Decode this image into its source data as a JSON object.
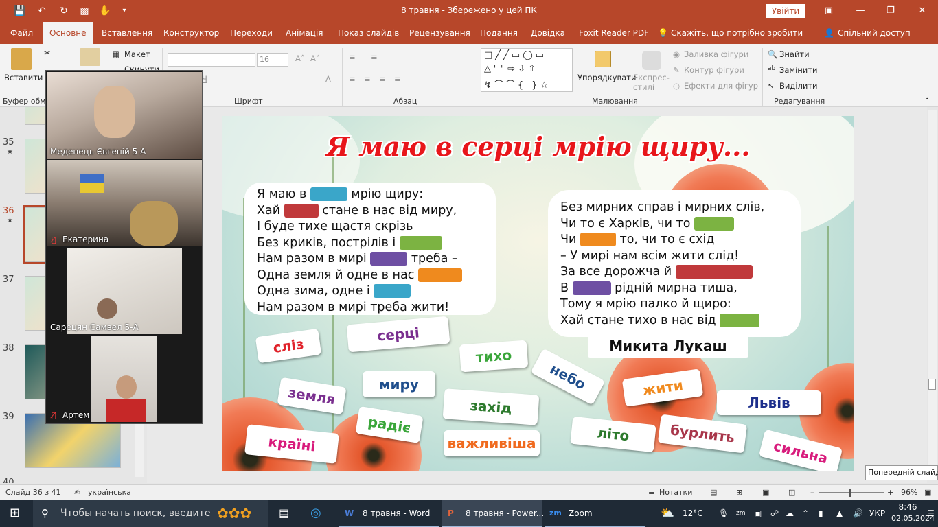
{
  "titlebar": {
    "title": "8 травня  -  Збережено у цей ПК",
    "signin": "Увійти",
    "icons": [
      "save-icon",
      "undo-icon",
      "redo-icon",
      "present-icon",
      "touch-icon",
      "customize-icon"
    ]
  },
  "menu": {
    "tabs": [
      "Файл",
      "Основне",
      "Вставлення",
      "Конструктор",
      "Переходи",
      "Анімація",
      "Показ слайдів",
      "Рецензування",
      "Подання",
      "Довідка",
      "Foxit Reader PDF"
    ],
    "tell_me": "Скажіть, що потрібно зробити",
    "share": "Спільний доступ"
  },
  "ribbon": {
    "paste": "Вставити",
    "clipboard": "Буфер обмі",
    "layout": "Макет",
    "reset": "Скинути",
    "font_group": "Шрифт",
    "font_size": "16",
    "paragraph_group": "Абзац",
    "drawing_group": "Малювання",
    "arrange": "Упорядкувати",
    "quick_styles": "Експрес-стилі",
    "shape_fill": "Заливка фігури",
    "shape_outline": "Контур фігури",
    "shape_effects": "Ефекти для фігур",
    "find": "Знайти",
    "replace": "Замінити",
    "select": "Виділити",
    "editing_group": "Редагування"
  },
  "thumbnails": [
    {
      "num": "35",
      "star": "★"
    },
    {
      "num": "36",
      "star": "★",
      "selected": true
    },
    {
      "num": "37",
      "star": ""
    },
    {
      "num": "38",
      "star": ""
    },
    {
      "num": "39",
      "star": ""
    },
    {
      "num": "40",
      "star": ""
    }
  ],
  "zoom": {
    "participants": [
      {
        "name": "Меденець Євгеній 5 А",
        "muted": false
      },
      {
        "name": "Екатерина",
        "muted": true
      },
      {
        "name": "Сарецян Самвел 5-А",
        "muted": false
      },
      {
        "name": "Артем",
        "muted": true
      }
    ]
  },
  "slide": {
    "title": "Я маю в серці мрію щиру...",
    "poem_left": [
      {
        "a": "Я маю в",
        "gap": "#3aa6c9",
        "b": "мрію щиру:"
      },
      {
        "a": "Хай",
        "gap": "#c0393b",
        "b": "стане в нас від миру,"
      },
      {
        "a": "І буде тихе щастя скрізь",
        "gap": "",
        "b": ""
      },
      {
        "a": "Без криків, пострілів і",
        "gap": "#7cb342",
        "b": ""
      },
      {
        "a": "Нам разом в мирі",
        "gap": "#6e4fa3",
        "b": "треба –"
      },
      {
        "a": "Одна земля й одне в нас",
        "gap": "#ef8a1e",
        "b": ""
      },
      {
        "a": "Одна зима, одне і",
        "gap": "#3aa6c9",
        "b": ""
      },
      {
        "a": "Нам разом в мирі треба жити!",
        "gap": "",
        "b": ""
      }
    ],
    "poem_right": [
      {
        "a": "Без мирних справ і мирних слів,",
        "gap": "",
        "b": ""
      },
      {
        "a": "Чи то є Харків, чи то",
        "gap": "#7cb342",
        "b": ""
      },
      {
        "a": "Чи",
        "gap": "#ef8a1e",
        "b": "то, чи то є схід"
      },
      {
        "a": "– У мирі нам всім жити слід!",
        "gap": "",
        "b": ""
      },
      {
        "a": "За все дорожча й",
        "gap": "#c0393b",
        "b": ""
      },
      {
        "a": "В",
        "gap": "#6e4fa3",
        "b": "рідній мирна тиша,"
      },
      {
        "a": "Тому я мрію палко й щиро:",
        "gap": "",
        "b": ""
      },
      {
        "a": "Хай стане тихо в нас від",
        "gap": "#7cb342",
        "b": ""
      }
    ],
    "author": "Микита Лукаш",
    "cards": [
      {
        "text": "сліз",
        "color": "#e0222a"
      },
      {
        "text": "серці",
        "color": "#7a2f8f"
      },
      {
        "text": "тихо",
        "color": "#3aa63a"
      },
      {
        "text": "небо",
        "color": "#1f4e8c"
      },
      {
        "text": "миру",
        "color": "#1f4e8c"
      },
      {
        "text": "земля",
        "color": "#7a2f8f"
      },
      {
        "text": "захід",
        "color": "#2d7a2d"
      },
      {
        "text": "жити",
        "color": "#f08a1e"
      },
      {
        "text": "Львів",
        "color": "#1d2f8c"
      },
      {
        "text": "радіє",
        "color": "#3aa63a"
      },
      {
        "text": "країні",
        "color": "#d81b7c"
      },
      {
        "text": "важливіша",
        "color": "#f06a1e"
      },
      {
        "text": "літо",
        "color": "#2d7a2d"
      },
      {
        "text": "бурлить",
        "color": "#a8364a"
      },
      {
        "text": "сильна",
        "color": "#d81b7c"
      }
    ]
  },
  "status": {
    "slide": "Слайд 36 з 41",
    "language": "українська",
    "notes": "Нотатки",
    "zoom": "96%"
  },
  "tooltip": "Попередній слайд",
  "taskbar": {
    "search": "Чтобы начать поиск, введите",
    "apps": [
      {
        "label": "8 травня - Word"
      },
      {
        "label": "8 травня - Power..."
      },
      {
        "label": "Zoom"
      }
    ],
    "temp": "12°C",
    "lang": "УКР",
    "time": "8:46",
    "date": "02.05.2024"
  }
}
